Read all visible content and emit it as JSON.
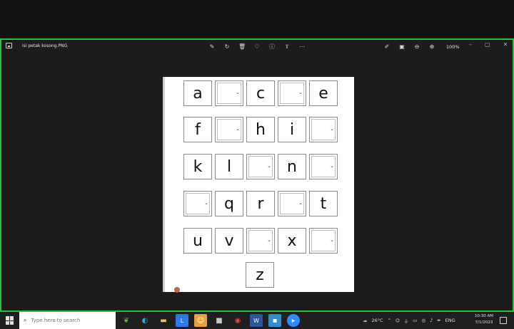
{
  "window": {
    "filename": "isi petak kosong.PNG",
    "zoom": "100%"
  },
  "grid": {
    "rows": [
      [
        {
          "t": "letter",
          "v": "a"
        },
        {
          "t": "dd"
        },
        {
          "t": "letter",
          "v": "c"
        },
        {
          "t": "dd"
        },
        {
          "t": "letter",
          "v": "e"
        }
      ],
      [
        {
          "t": "letter",
          "v": "f"
        },
        {
          "t": "dd"
        },
        {
          "t": "letter",
          "v": "h"
        },
        {
          "t": "letter",
          "v": "i"
        },
        {
          "t": "dd"
        }
      ],
      [
        {
          "t": "letter",
          "v": "k"
        },
        {
          "t": "letter",
          "v": "l"
        },
        {
          "t": "dd"
        },
        {
          "t": "letter",
          "v": "n"
        },
        {
          "t": "dd"
        }
      ],
      [
        {
          "t": "dd"
        },
        {
          "t": "letter",
          "v": "q"
        },
        {
          "t": "letter",
          "v": "r"
        },
        {
          "t": "dd"
        },
        {
          "t": "letter",
          "v": "t"
        }
      ],
      [
        {
          "t": "letter",
          "v": "u"
        },
        {
          "t": "letter",
          "v": "v"
        },
        {
          "t": "dd"
        },
        {
          "t": "letter",
          "v": "x"
        },
        {
          "t": "dd"
        }
      ]
    ],
    "last": "z"
  },
  "taskbar": {
    "search_placeholder": "Type here to search",
    "temperature": "26°C",
    "language": "ENG",
    "time": "10:30 AM",
    "date": "7/1/2023"
  },
  "colors": {
    "window_border": "#2fbf3a",
    "dropdown_chevron": "#2a3a8a"
  }
}
